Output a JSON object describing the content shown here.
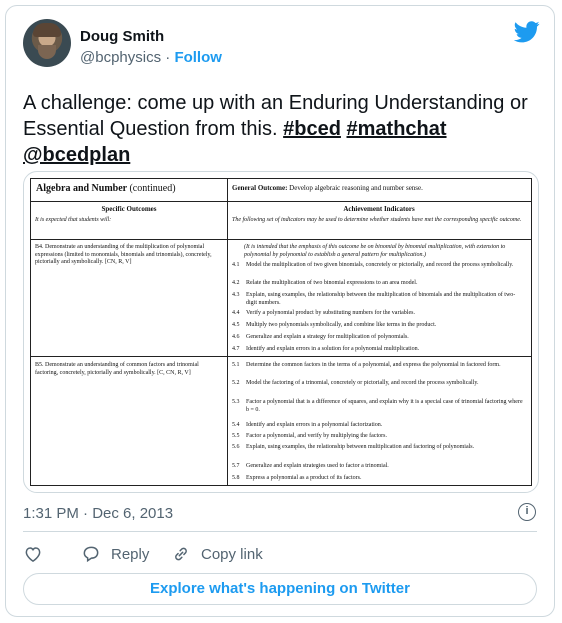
{
  "author": {
    "name": "Doug Smith",
    "handle": "@bcphysics",
    "separator": "·",
    "follow_label": "Follow"
  },
  "tweet": {
    "text": "A challenge: come up with an Enduring Understanding or Essential Question from this.",
    "hashtags": [
      "#bced",
      "#mathchat"
    ],
    "mention": "@bcedplan",
    "timestamp": "1:31 PM · Dec 6, 2013",
    "info_glyph": "i"
  },
  "document": {
    "header_left": "Algebra and Number",
    "header_left_suffix": "(continued)",
    "header_right_label": "General Outcome:",
    "header_right_text": "Develop algebraic reasoning and number sense.",
    "col_left_title": "Specific Outcomes",
    "col_left_sub": "It is expected that students will:",
    "col_right_title": "Achievement Indicators",
    "col_right_sub": "The following set of indicators may be used to determine whether students have met the corresponding specific outcome.",
    "b4_outcome": "B4. Demonstrate an understanding of the multiplication of polynomial expressions (limited to monomials, binomials and trinomials), concretely, pictorially and symbolically. [CN, R, V]",
    "b4_intro": "(It is intended that the emphasis of this outcome be on binomial by binomial multiplication, with extension to polynomial by polynomial to establish a general pattern for multiplication.)",
    "b4_indicators": [
      {
        "num": "4.1",
        "text": "Model the multiplication of two given binomials, concretely or pictorially, and record the process symbolically."
      },
      {
        "num": "4.2",
        "text": "Relate the multiplication of two binomial expressions to an area model."
      },
      {
        "num": "4.3",
        "text": "Explain, using examples, the relationship between the multiplication of binomials and the multiplication of two-digit numbers."
      },
      {
        "num": "4.4",
        "text": "Verify a polynomial product by substituting numbers for the variables."
      },
      {
        "num": "4.5",
        "text": "Multiply two polynomials symbolically, and combine like terms in the product."
      },
      {
        "num": "4.6",
        "text": "Generalize and explain a strategy for multiplication of polynomials."
      },
      {
        "num": "4.7",
        "text": "Identify and explain errors in a solution for a polynomial multiplication."
      }
    ],
    "b5_outcome": "B5. Demonstrate an understanding of common factors and trinomial factoring, concretely, pictorially and symbolically. [C, CN, R, V]",
    "b5_indicators": [
      {
        "num": "5.1",
        "text": "Determine the common factors in the terms of a polynomial, and express the polynomial in factored form."
      },
      {
        "num": "5.2",
        "text": "Model the factoring of a trinomial, concretely or pictorially, and record the process symbolically."
      },
      {
        "num": "5.3",
        "text": "Factor a polynomial that is a difference of squares, and explain why it is a special case of trinomial factoring where b = 0."
      },
      {
        "num": "5.4",
        "text": "Identify and explain errors in a polynomial factorization."
      },
      {
        "num": "5.5",
        "text": "Factor a polynomial, and verify by multiplying the factors."
      },
      {
        "num": "5.6",
        "text": "Explain, using examples, the relationship between multiplication and factoring of polynomials."
      },
      {
        "num": "5.7",
        "text": "Generalize and explain strategies used to factor a trinomial."
      },
      {
        "num": "5.8",
        "text": "Express a polynomial as a product of its factors."
      }
    ]
  },
  "actions": {
    "reply_label": "Reply",
    "copy_link_label": "Copy link",
    "explore_label": "Explore what's happening on Twitter"
  },
  "colors": {
    "accent": "#1d9bf0",
    "muted": "#536471",
    "border": "#cfd9de"
  }
}
